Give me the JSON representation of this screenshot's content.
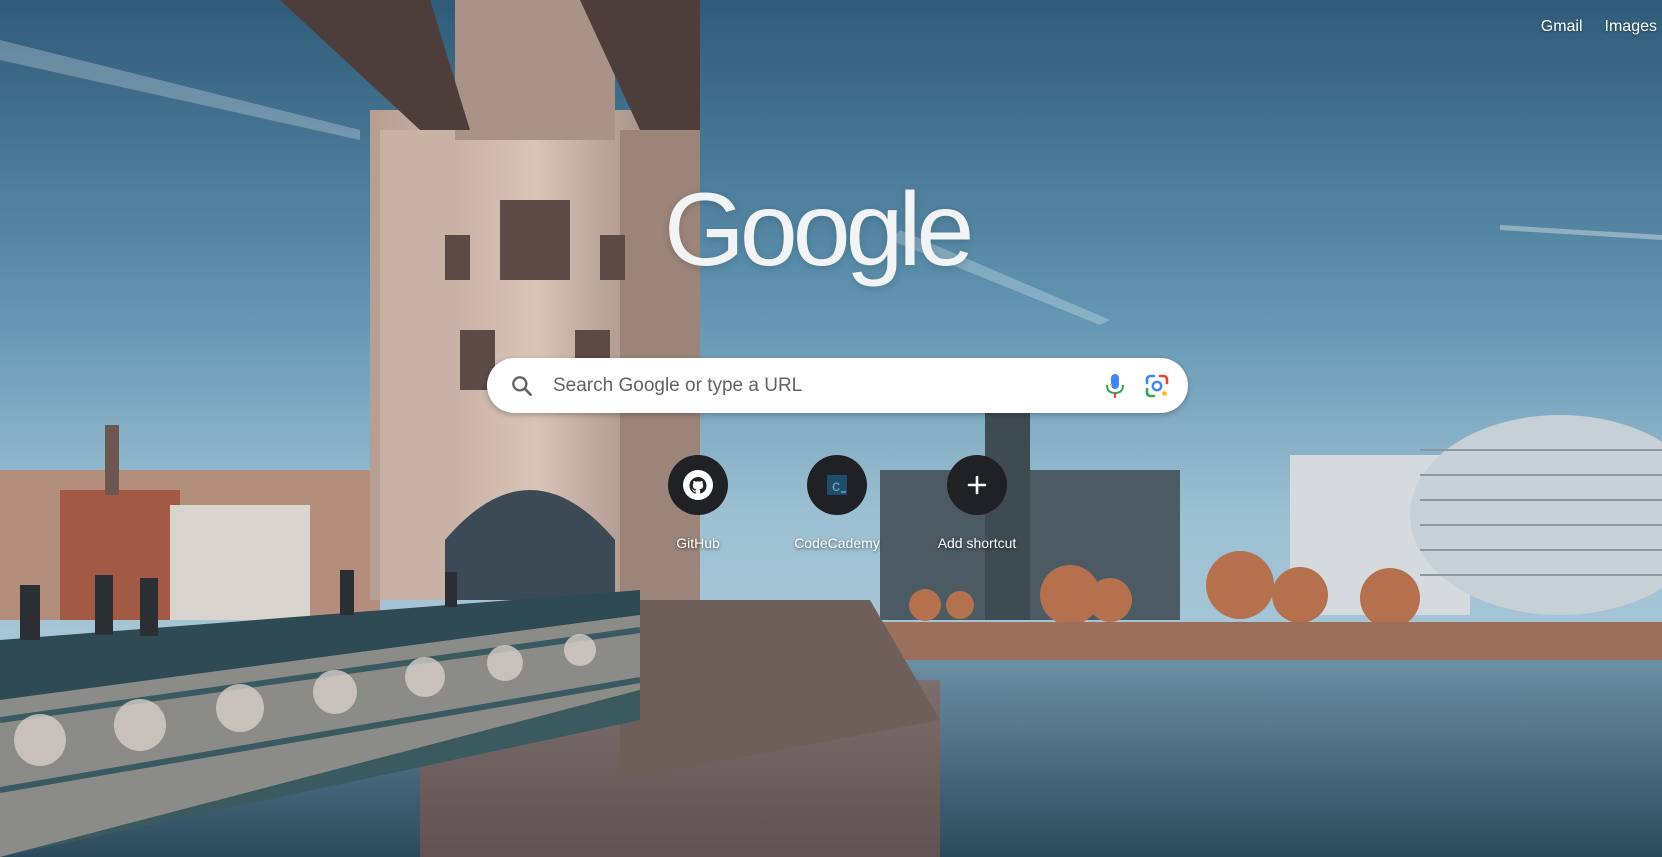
{
  "header": {
    "links": [
      {
        "label": "Gmail"
      },
      {
        "label": "Images"
      }
    ]
  },
  "logo": {
    "text": "Google"
  },
  "search": {
    "placeholder": "Search Google or type a URL",
    "value": "",
    "icons": [
      "search-icon",
      "microphone-icon",
      "google-lens-icon"
    ]
  },
  "shortcuts": [
    {
      "label": "GitHub",
      "icon": "github-icon"
    },
    {
      "label": "CodeCademy",
      "icon": "codecademy-icon"
    },
    {
      "label": "Add shortcut",
      "icon": "plus-icon"
    }
  ],
  "colors": {
    "mic_blue": "#4285F4",
    "mic_red": "#EA4335",
    "lens_green": "#34A853",
    "lens_yellow": "#FBBC05",
    "tile": "#202124"
  }
}
